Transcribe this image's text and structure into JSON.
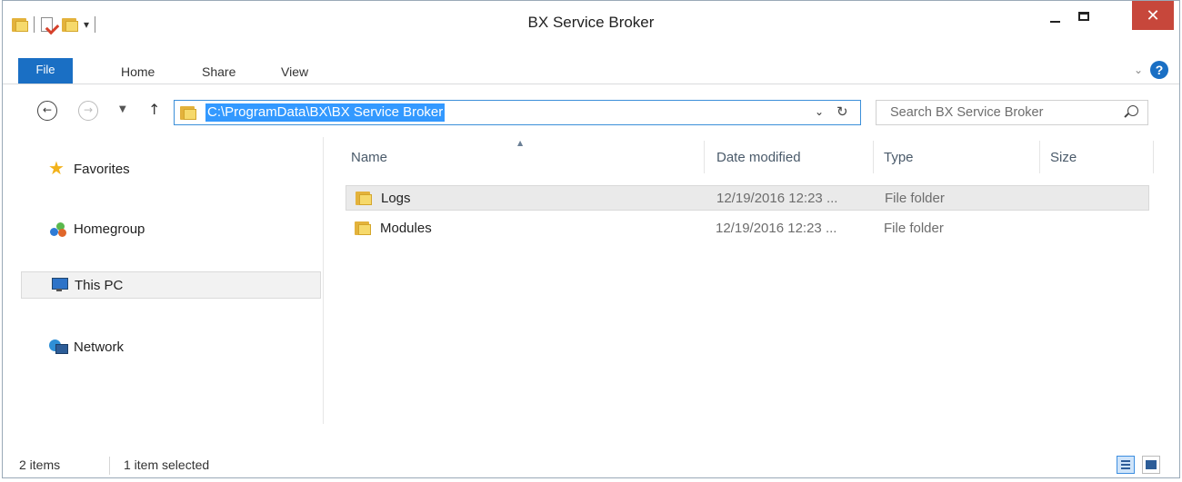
{
  "window": {
    "title": "BX Service Broker",
    "close_glyph": "✕",
    "accent_color": "#1a6fc4",
    "close_color": "#c7473b"
  },
  "qat": {
    "dropdown_glyph": "▾"
  },
  "ribbon": {
    "tabs": [
      "File",
      "Home",
      "Share",
      "View"
    ],
    "collapse_glyph": "⌄",
    "help_glyph": "?"
  },
  "nav": {
    "back_glyph": "←",
    "forward_glyph": "→",
    "recent_glyph": "▼",
    "up_glyph": "↑",
    "address": "C:\\ProgramData\\BX\\BX Service Broker",
    "address_dropdown_glyph": "⌄",
    "refresh_glyph": "↻",
    "search_placeholder": "Search BX Service Broker"
  },
  "navpane": {
    "items": [
      {
        "label": "Favorites",
        "icon": "star-icon",
        "selected": false
      },
      {
        "label": "Homegroup",
        "icon": "homegroup-icon",
        "selected": false
      },
      {
        "label": "This PC",
        "icon": "computer-icon",
        "selected": true
      },
      {
        "label": "Network",
        "icon": "network-icon",
        "selected": false
      }
    ],
    "star_glyph": "★"
  },
  "filelist": {
    "columns": [
      "Name",
      "Date modified",
      "Type",
      "Size"
    ],
    "sort_glyph": "▲",
    "rows": [
      {
        "name": "Logs",
        "date": "12/19/2016 12:23 ...",
        "type": "File folder",
        "size": "",
        "selected": true
      },
      {
        "name": "Modules",
        "date": "12/19/2016 12:23 ...",
        "type": "File folder",
        "size": "",
        "selected": false
      }
    ]
  },
  "status": {
    "item_count": "2 items",
    "selection": "1 item selected"
  }
}
